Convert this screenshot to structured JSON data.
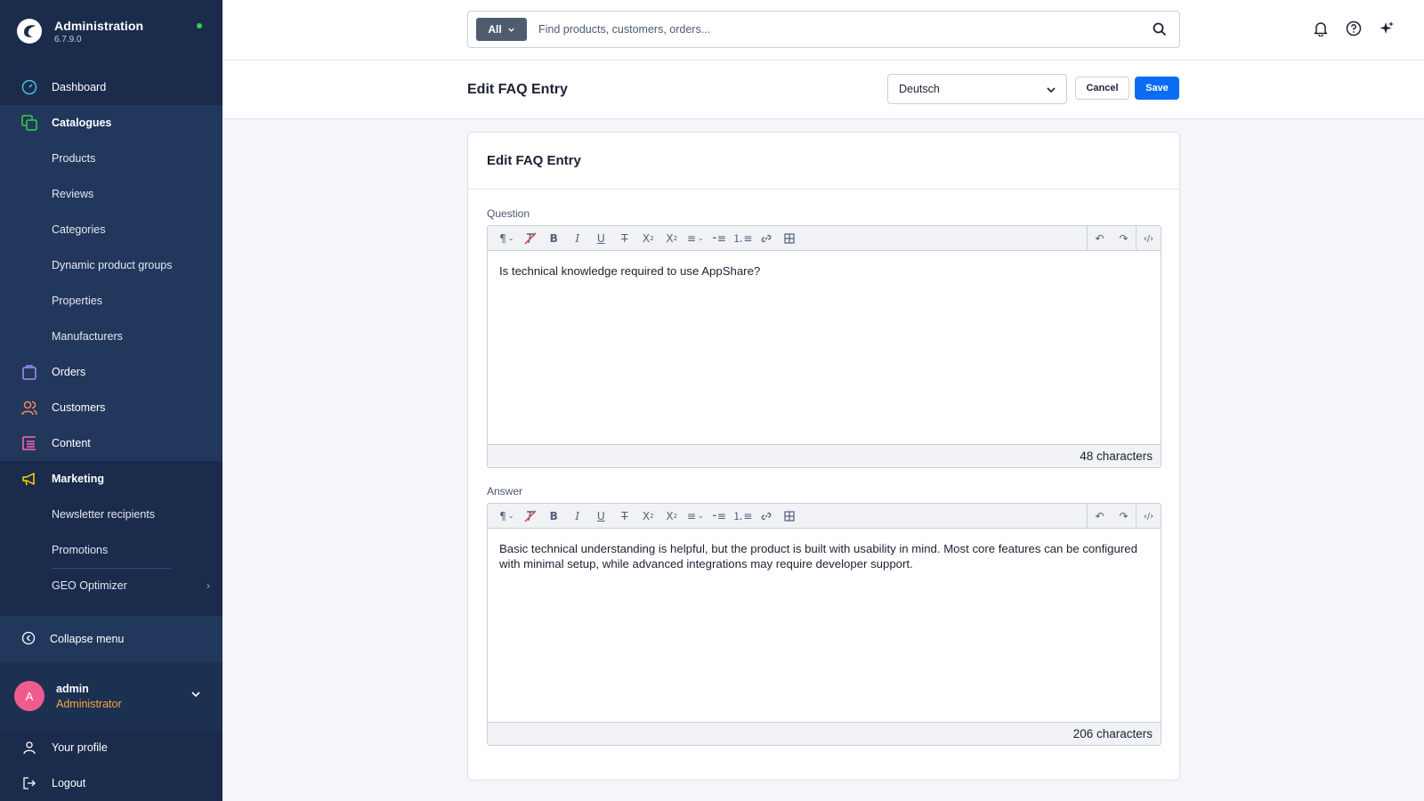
{
  "app": {
    "title": "Administration",
    "version": "6.7.9.0",
    "status_color": "#37d046"
  },
  "sidebar": {
    "items": [
      {
        "label": "Dashboard",
        "icon": "dashboard-icon",
        "color": "#4ac1d8"
      },
      {
        "label": "Catalogues",
        "icon": "catalogues-icon",
        "color": "#37d046"
      },
      {
        "label": "Products"
      },
      {
        "label": "Reviews"
      },
      {
        "label": "Categories"
      },
      {
        "label": "Dynamic product groups"
      },
      {
        "label": "Properties"
      },
      {
        "label": "Manufacturers"
      },
      {
        "label": "Orders",
        "icon": "orders-icon",
        "color": "#a092f0"
      },
      {
        "label": "Customers",
        "icon": "customers-icon",
        "color": "#f88962"
      },
      {
        "label": "Content",
        "icon": "content-icon",
        "color": "#ff68b4"
      },
      {
        "label": "Marketing",
        "icon": "marketing-icon",
        "color": "#ffd700"
      },
      {
        "label": "Newsletter recipients"
      },
      {
        "label": "Promotions"
      },
      {
        "label": "GEO Optimizer"
      }
    ],
    "collapse_label": "Collapse menu",
    "user": {
      "initial": "A",
      "name": "admin",
      "role": "Administrator"
    },
    "bottom": [
      {
        "label": "Your profile"
      },
      {
        "label": "Logout"
      }
    ]
  },
  "search": {
    "scope": "All",
    "placeholder": "Find products, customers, orders..."
  },
  "header": {
    "title": "Edit FAQ Entry",
    "language": "Deutsch",
    "cancel_label": "Cancel",
    "save_label": "Save"
  },
  "card": {
    "title": "Edit FAQ Entry",
    "question": {
      "label": "Question",
      "value": "Is technical knowledge required to use AppShare?",
      "count": "48 characters"
    },
    "answer": {
      "label": "Answer",
      "value": "Basic technical understanding is helpful, but the product is built with usability in mind. Most core features can be configured with minimal setup, while advanced integrations may require developer support.",
      "count": "206 characters"
    }
  },
  "colors": {
    "accent": "#0a6cf2",
    "sidebar": "#1a2b4c"
  }
}
